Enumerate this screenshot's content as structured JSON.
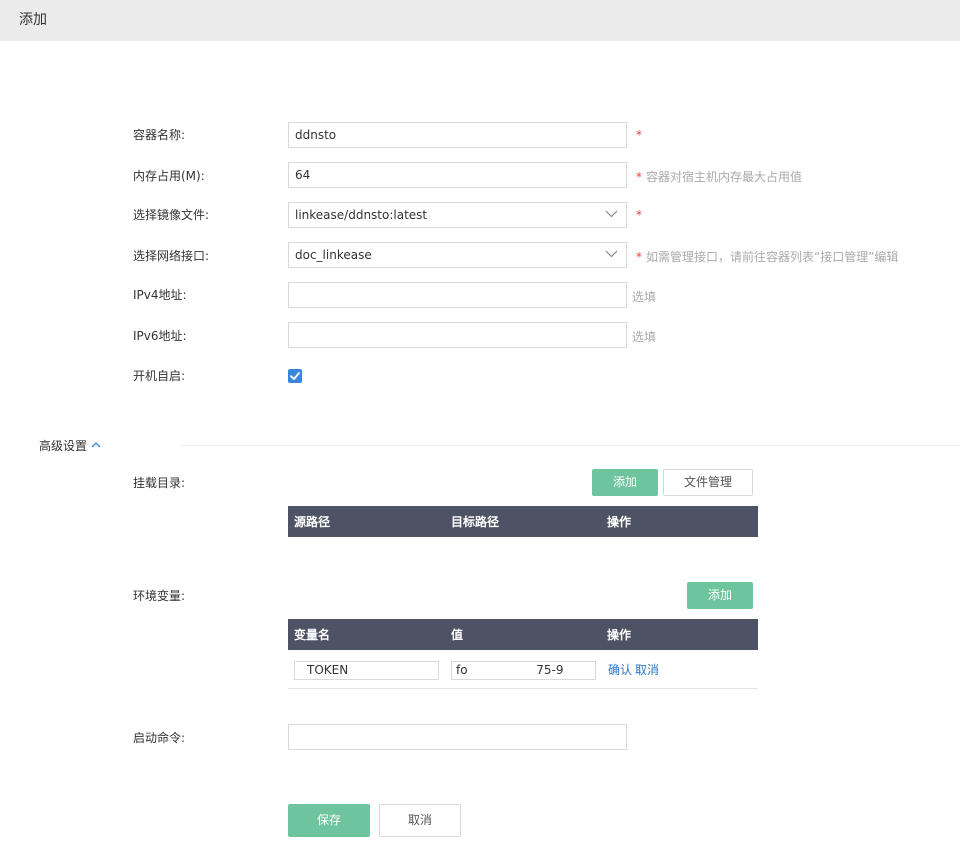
{
  "header": {
    "title": "添加"
  },
  "form": {
    "name": {
      "label": "容器名称:",
      "value": "ddnsto",
      "required": "*"
    },
    "memory": {
      "label": "内存占用(M):",
      "value": "64",
      "required": "*",
      "hint": "容器对宿主机内存最大占用值"
    },
    "image": {
      "label": "选择镜像文件:",
      "value": "linkease/ddnsto:latest",
      "required": "*"
    },
    "network": {
      "label": "选择网络接口:",
      "value": "doc_linkease",
      "required": "*",
      "hint": "如需管理接口，请前往容器列表“接口管理”编辑"
    },
    "ipv4": {
      "label": "IPv4地址:",
      "value": "",
      "optional": "选填"
    },
    "ipv6": {
      "label": "IPv6地址:",
      "value": "",
      "optional": "选填"
    },
    "autostart": {
      "label": "开机自启:",
      "checked": true
    }
  },
  "advanced": {
    "label": "高级设置",
    "mounts": {
      "label": "挂载目录:",
      "add_label": "添加",
      "files_label": "文件管理",
      "columns": [
        "源路径",
        "目标路径",
        "操作"
      ]
    },
    "env": {
      "label": "环境变量:",
      "add_label": "添加",
      "columns": [
        "变量名",
        "值",
        "操作"
      ],
      "rows": [
        {
          "name": "TOKEN",
          "value": "fo                  75-9",
          "confirm": "确认",
          "cancel": "取消"
        }
      ]
    },
    "command": {
      "label": "启动命令:",
      "value": ""
    }
  },
  "footer": {
    "save_label": "保存",
    "cancel_label": "取消"
  },
  "colors": {
    "accent": "#6ec59d",
    "link": "#2a77c7",
    "required": "#e64545",
    "table_header": "#4d5264"
  }
}
